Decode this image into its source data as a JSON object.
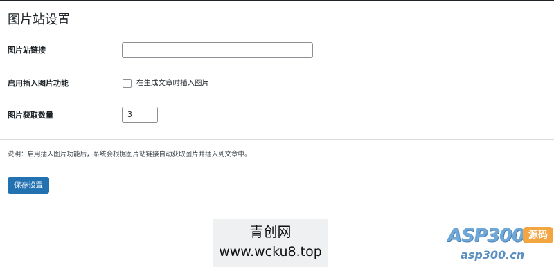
{
  "page": {
    "title": "图片站设置"
  },
  "form": {
    "site_link": {
      "label": "图片站链接",
      "value": ""
    },
    "enable_insert": {
      "label": "启用插入图片功能",
      "checkbox_label": "在生成文章时插入图片",
      "checked": false
    },
    "fetch_count": {
      "label": "图片获取数量",
      "value": "3"
    }
  },
  "description": "说明：启用插入图片功能后，系统会根据图片站链接自动获取图片并插入到文章中。",
  "actions": {
    "save_label": "保存设置"
  },
  "watermark": {
    "line1": "青创网",
    "line2": "www.wcku8.top"
  },
  "logo": {
    "main": "ASP300",
    "badge": "源码",
    "sub": "asp300.cn"
  },
  "colors": {
    "primary_button": "#2271b1",
    "input_border": "#8c8f94",
    "logo_blue": "#6fa8d6",
    "logo_orange": "#f2a541"
  }
}
